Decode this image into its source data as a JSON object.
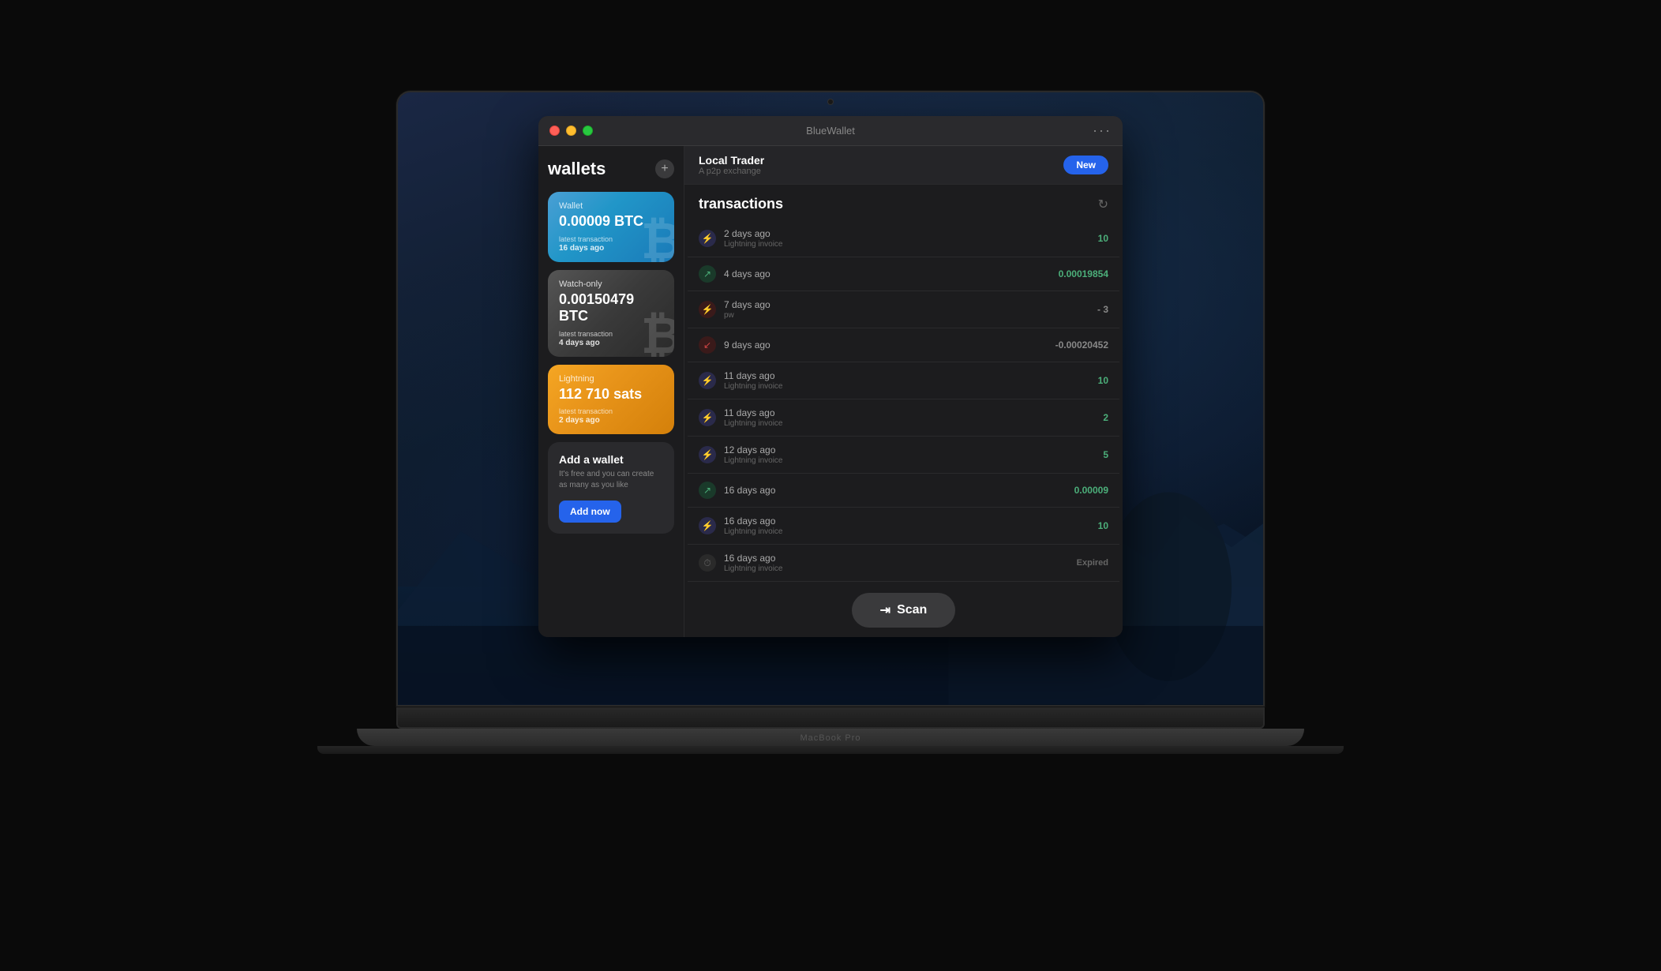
{
  "window": {
    "title": "BlueWallet",
    "traffic_lights": [
      "close",
      "minimize",
      "maximize"
    ],
    "menu_dots": "···"
  },
  "sidebar": {
    "title": "wallets",
    "add_button": "+",
    "wallets": [
      {
        "id": "btc-wallet",
        "label": "Wallet",
        "amount": "0.00009 BTC",
        "sub_label": "latest transaction",
        "date": "16 days ago",
        "type": "btc"
      },
      {
        "id": "watch-only-wallet",
        "label": "Watch-only",
        "amount": "0.00150479 BTC",
        "sub_label": "latest transaction",
        "date": "4 days ago",
        "type": "watch"
      },
      {
        "id": "lightning-wallet",
        "label": "Lightning",
        "amount": "112 710 sats",
        "sub_label": "latest transaction",
        "date": "2 days ago",
        "type": "lightning"
      }
    ],
    "add_wallet": {
      "title": "Add a wallet",
      "description": "It's free and you can create as many as you like",
      "button_label": "Add now"
    }
  },
  "local_trader": {
    "name": "Local Trader",
    "subtitle": "A p2p exchange",
    "badge": "New"
  },
  "transactions": {
    "title": "transactions",
    "items": [
      {
        "id": "tx1",
        "time": "2 days ago",
        "desc": "Lightning invoice",
        "amount": "10",
        "type": "lightning-in"
      },
      {
        "id": "tx2",
        "time": "4 days ago",
        "desc": "",
        "amount": "0.00019854",
        "type": "btc-in"
      },
      {
        "id": "tx3",
        "time": "7 days ago",
        "desc": "pw",
        "amount": "- 3",
        "type": "lightning-out"
      },
      {
        "id": "tx4",
        "time": "9 days ago",
        "desc": "",
        "amount": "-0.00020452",
        "type": "btc-out"
      },
      {
        "id": "tx5",
        "time": "11 days ago",
        "desc": "Lightning invoice",
        "amount": "10",
        "type": "lightning-in"
      },
      {
        "id": "tx6",
        "time": "11 days ago",
        "desc": "Lightning invoice",
        "amount": "2",
        "type": "lightning-in"
      },
      {
        "id": "tx7",
        "time": "12 days ago",
        "desc": "Lightning invoice",
        "amount": "5",
        "type": "lightning-in"
      },
      {
        "id": "tx8",
        "time": "16 days ago",
        "desc": "",
        "amount": "0.00009",
        "type": "btc-in"
      },
      {
        "id": "tx9",
        "time": "16 days ago",
        "desc": "Lightning invoice",
        "amount": "10",
        "type": "lightning-in"
      },
      {
        "id": "tx10",
        "time": "16 days ago",
        "desc": "Lightning invoice",
        "amount": "Expired",
        "type": "expired"
      }
    ]
  },
  "scan_button": {
    "label": "Scan",
    "icon": "⇥"
  },
  "macbook": {
    "label": "MacBook Pro"
  }
}
